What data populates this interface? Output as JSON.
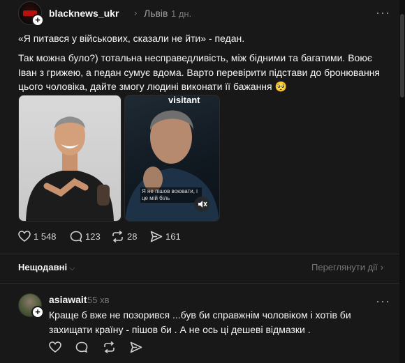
{
  "post": {
    "username": "blacknews_ukr",
    "location": "Львів",
    "time": "1 дн.",
    "more_label": "···",
    "text_line1": "«Я питався у військових, сказали не йти» - педан.",
    "text_body": "Так можна було?) тотальна несправедливість, між бідними та багатими. Воює Іван з грижею, а педан сумує вдома. Варто перевірити підстави до бронювання цього чоловіка, дайте змогу людині виконати її бажання 🥺",
    "media": [
      {
        "kind": "photo",
        "icon": "person-photo"
      },
      {
        "kind": "video",
        "overlay_text": "visitant",
        "subtitle": "Я не пішов воювати, і це мій біль",
        "icon": "mute-icon"
      }
    ],
    "stats": {
      "likes": "1 548",
      "comments": "123",
      "reposts": "28",
      "shares": "161"
    }
  },
  "sort": {
    "label": "Нещодавні",
    "caret": "⌵",
    "view_activity": "Переглянути дії",
    "view_arrow": "›"
  },
  "comment": {
    "username": "asiawait",
    "time": "55 хв",
    "text": "Краще б вже не позорився ...був би справжнім чоловіком і хотів би захищати країну - пішов би . А не ось ці дешеві відмазки .",
    "more_label": "···"
  },
  "colors": {
    "background": "#181818",
    "text": "#f3f5f7",
    "muted": "#777777",
    "divider": "#2d2d2d"
  }
}
